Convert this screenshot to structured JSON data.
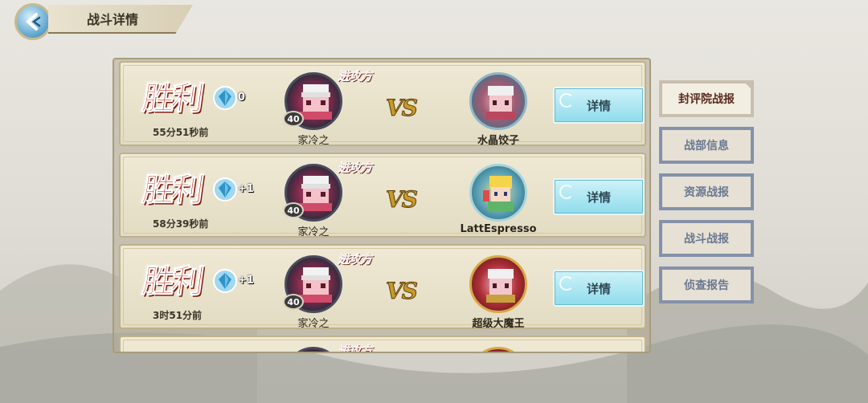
{
  "header": {
    "title": "战斗详情"
  },
  "battles": [
    {
      "result": "胜利",
      "gem_count": "0",
      "time_ago": "55分51秒前",
      "attacker_tag": "进攻方",
      "left_name": "家冷之",
      "left_level": "40",
      "vs": "VS",
      "right_name": "水晶饺子",
      "detail_label": "详情"
    },
    {
      "result": "胜利",
      "gem_count": "+1",
      "time_ago": "58分39秒前",
      "attacker_tag": "进攻方",
      "left_name": "家冷之",
      "left_level": "40",
      "vs": "VS",
      "right_name": "LattEspresso",
      "detail_label": "详情"
    },
    {
      "result": "胜利",
      "gem_count": "+1",
      "time_ago": "3时51分前",
      "attacker_tag": "进攻方",
      "left_name": "家冷之",
      "left_level": "40",
      "vs": "VS",
      "right_name": "超级大魔王",
      "detail_label": "详情"
    },
    {
      "result": "",
      "gem_count": "",
      "time_ago": "",
      "attacker_tag": "进攻方",
      "left_name": "",
      "left_level": "",
      "vs": "",
      "right_name": "",
      "detail_label": ""
    }
  ],
  "side_tabs": [
    {
      "label": "封评院战报",
      "active": true
    },
    {
      "label": "战部信息",
      "active": false
    },
    {
      "label": "资源战报",
      "active": false
    },
    {
      "label": "战斗战报",
      "active": false
    },
    {
      "label": "侦查报告",
      "active": false
    }
  ],
  "colors": {
    "win_red": "#c2301c",
    "button_cyan": "#8fdcec",
    "tab_border": "#8591a8"
  }
}
